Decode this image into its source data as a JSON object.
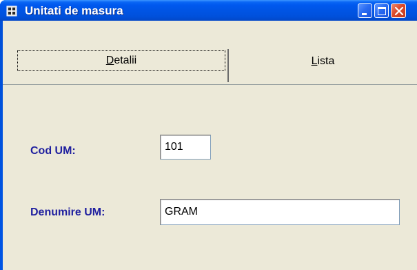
{
  "window": {
    "title": "Unitati de masura",
    "icon": "app-icon",
    "controls": {
      "minimize": "minimize-icon",
      "maximize": "maximize-icon",
      "close": "close-icon"
    }
  },
  "tabs": [
    {
      "label_accel": "D",
      "label_rest": "etalii",
      "selected": true
    },
    {
      "label_accel": "L",
      "label_rest": "ista",
      "selected": false
    }
  ],
  "form": {
    "cod_um": {
      "label": "Cod UM:",
      "value": "101"
    },
    "denumire_um": {
      "label": "Denumire UM:",
      "value": "GRAM"
    }
  },
  "colors": {
    "titlebar": "#0054e3",
    "client_background": "#ece9d8",
    "label_text": "#1f1f9f",
    "close_button": "#dc4a2a"
  }
}
